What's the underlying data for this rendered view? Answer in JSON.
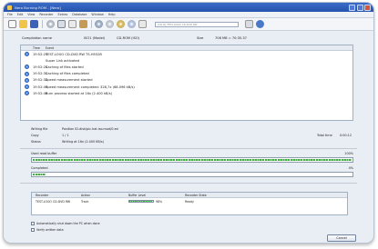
{
  "window": {
    "title": "Nero Burning ROM - [Nero]"
  },
  "menu": [
    "File",
    "Edit",
    "View",
    "Recorder",
    "Extras",
    "Database",
    "Window",
    "Help"
  ],
  "toolbar": {
    "icons": [
      "new-icon",
      "open-icon",
      "save-icon",
      "burn-icon",
      "copy-icon",
      "cut-icon",
      "paste-icon",
      "disc-info-icon",
      "eject-icon",
      "cd-icon",
      "dvd-icon",
      "erase-icon",
      "wizard-icon",
      "help-icon"
    ],
    "drive_select": "[CD-R] TEST-LOGO CD-DVD RW"
  },
  "compilation": {
    "label": "Compilation name",
    "name": "ISO1 (Model)",
    "type": "CD-ROM (ISO)",
    "size_label": "Size",
    "size": "708 MB = 70:35.37"
  },
  "log": {
    "headers": {
      "time": "Time",
      "event": "Event"
    },
    "rows": [
      {
        "time": "19:52:25",
        "event": "TEST-LOGO CD-DVD RW TS-H552B"
      },
      {
        "time": "",
        "event": "Super Link activated"
      },
      {
        "time": "19:52:25",
        "event": "Caching of files started"
      },
      {
        "time": "19:52:31",
        "event": "Caching of files completed"
      },
      {
        "time": "19:52:32",
        "event": "Speed measurement started"
      },
      {
        "time": "19:52:49",
        "event": "Speed measurement completed: 328,7x (68.096 kB/s)"
      },
      {
        "time": "19:52:49",
        "event": "Burn process started at 16x (2.400 kB/s)"
      }
    ]
  },
  "status": {
    "writing_to_label": "Writing file",
    "writing_to": "Position ID-disk/pic.hat.iso.mod/0.ecl",
    "copy_label": "Copy",
    "copy": "1 / 1",
    "status_label": "Status",
    "status": "Writing at 16x (2.400 KB/s)",
    "total_time_label": "Total time",
    "total_time": "0:00:12"
  },
  "buffer": {
    "label": "Used read buffer",
    "percent_text": "100%",
    "percent": 100
  },
  "completed": {
    "label": "Completed",
    "percent_text": "4%",
    "percent": 4
  },
  "recorders": {
    "headers": {
      "recorder": "Recorder",
      "action": "Action",
      "buffer": "Buffer Level",
      "state": "Recorder State"
    },
    "rows": [
      {
        "recorder": "TEST-LOGO CD-DVD RW",
        "action": "Track",
        "buffer_text": "98%",
        "buffer": 98,
        "state": "Ready"
      }
    ]
  },
  "options": {
    "auto_shutdown": "Automatically shut down the PC when done",
    "verify": "Verify written data"
  },
  "buttons": {
    "cancel": "Cancel"
  },
  "colors": {
    "progress": "#3cae3c",
    "titlebar": "#2553ad"
  }
}
